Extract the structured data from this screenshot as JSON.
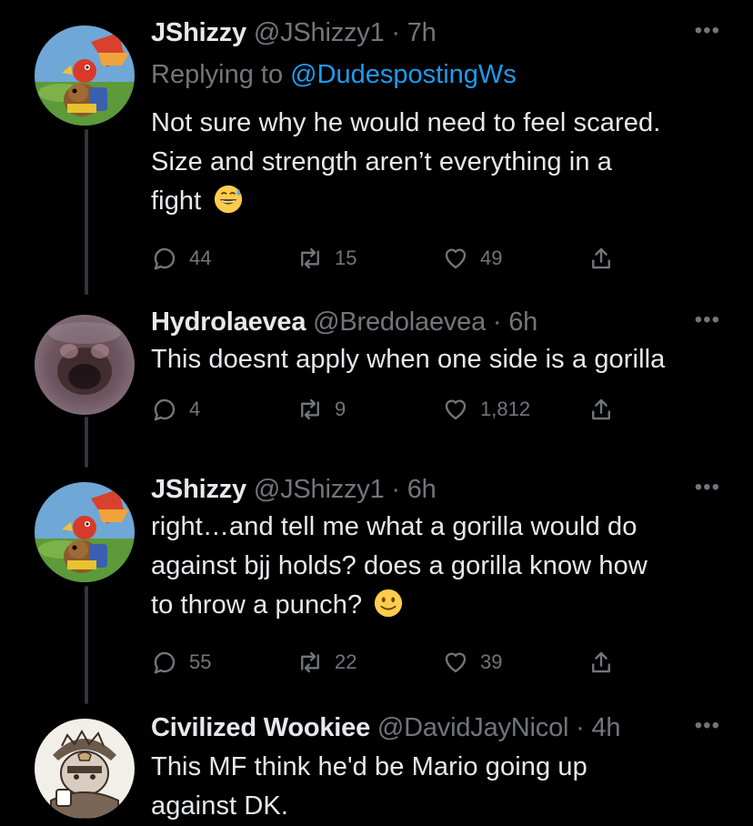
{
  "colors": {
    "background": "#000000",
    "primary_text": "#e7e9ea",
    "secondary_text": "#71767b",
    "link": "#1d9bf0",
    "thread_line": "#333639"
  },
  "tweets": [
    {
      "name": "JShizzy",
      "handle": "@JShizzy1",
      "sep": "·",
      "time": "7h",
      "reply_prefix": "Replying to ",
      "reply_mention": "@DudespostingWs",
      "lines": [
        "Not sure why he would need to feel scared.",
        "Size and strength aren’t everything in a",
        "fight"
      ],
      "emoji": "grinning-sweat-emoji",
      "more": "•••",
      "replies": "44",
      "retweets": "15",
      "likes": "49",
      "avatar": "banjo-kazooie-avatar"
    },
    {
      "name": "Hydrolaevea",
      "handle": "@Bredolaevea",
      "sep": "·",
      "time": "6h",
      "lines": [
        "This doesnt apply when one side is a gorilla"
      ],
      "more": "•••",
      "replies": "4",
      "retweets": "9",
      "likes": "1,812",
      "avatar": "blurred-face-avatar"
    },
    {
      "name": "JShizzy",
      "handle": "@JShizzy1",
      "sep": "·",
      "time": "6h",
      "lines": [
        "right…and tell me what a gorilla would do",
        "against bjj holds? does a gorilla know how",
        "to throw a punch?"
      ],
      "emoji": "slightly-smiling-emoji",
      "more": "•••",
      "replies": "55",
      "retweets": "22",
      "likes": "39",
      "avatar": "banjo-kazooie-avatar"
    },
    {
      "name": "Civilized Wookiee",
      "handle": "@DavidJayNicol",
      "sep": "·",
      "time": "4h",
      "lines": [
        "This MF think he'd be Mario going up",
        "against DK."
      ],
      "more": "•••",
      "avatar": "sketch-character-avatar"
    }
  ],
  "icons": {
    "reply": "reply-icon",
    "retweet": "retweet-icon",
    "like": "heart-icon",
    "share": "share-icon"
  }
}
